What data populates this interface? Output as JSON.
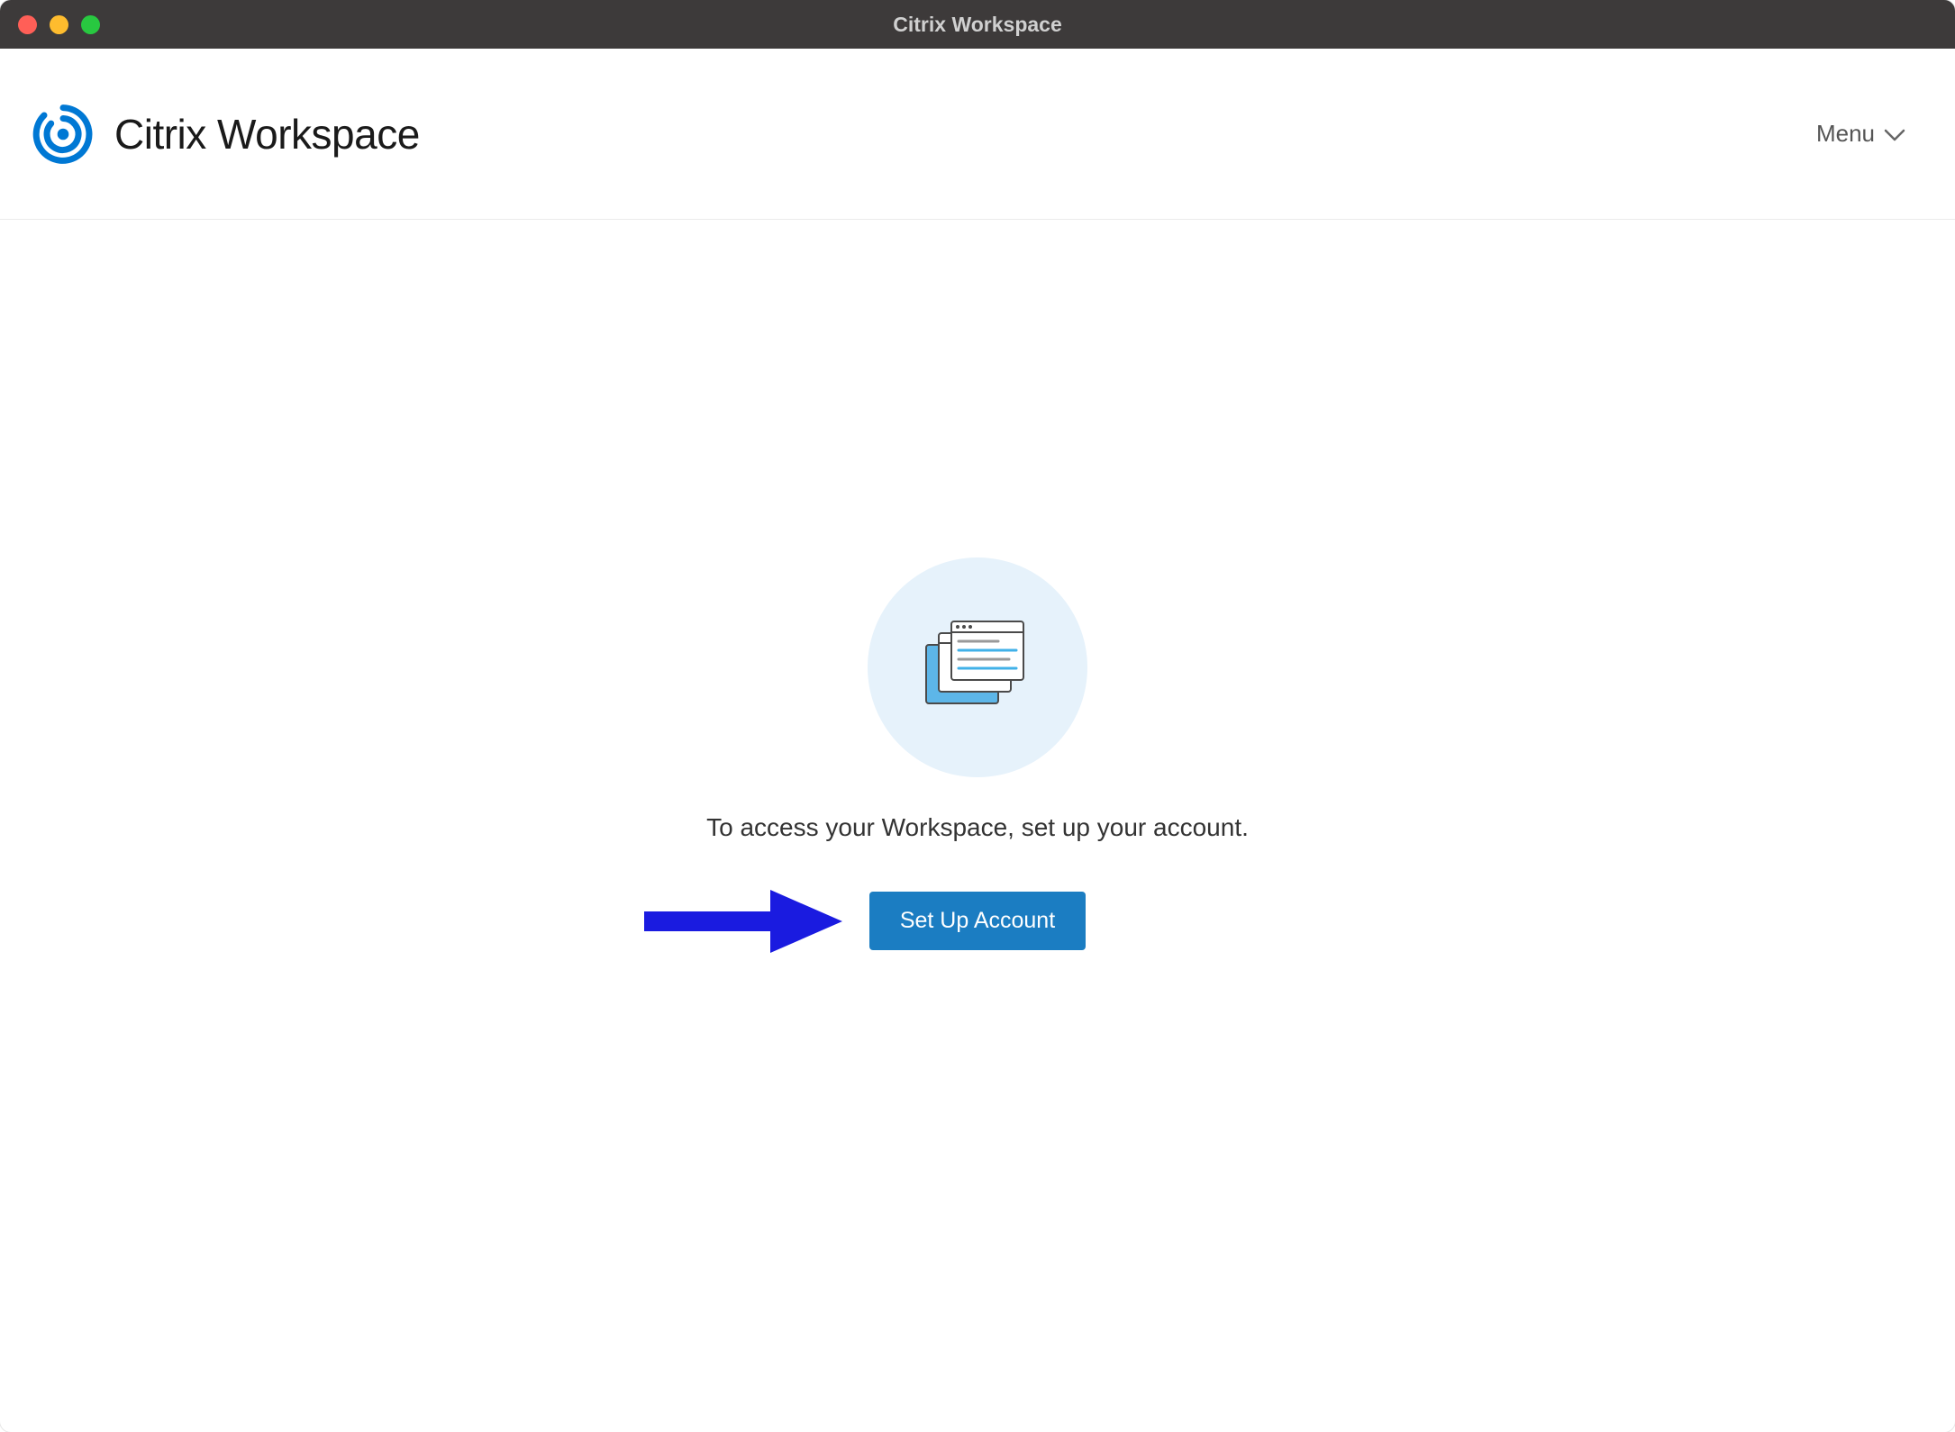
{
  "window": {
    "title": "Citrix Workspace"
  },
  "header": {
    "brand_text": "Citrix Workspace",
    "menu_label": "Menu"
  },
  "content": {
    "prompt": "To access your Workspace, set up your account.",
    "setup_button_label": "Set Up Account"
  },
  "colors": {
    "accent": "#1b7dc2",
    "logo": "#0078d4",
    "arrow": "#1a1be0",
    "illustration_bg": "#e6f2fb"
  }
}
